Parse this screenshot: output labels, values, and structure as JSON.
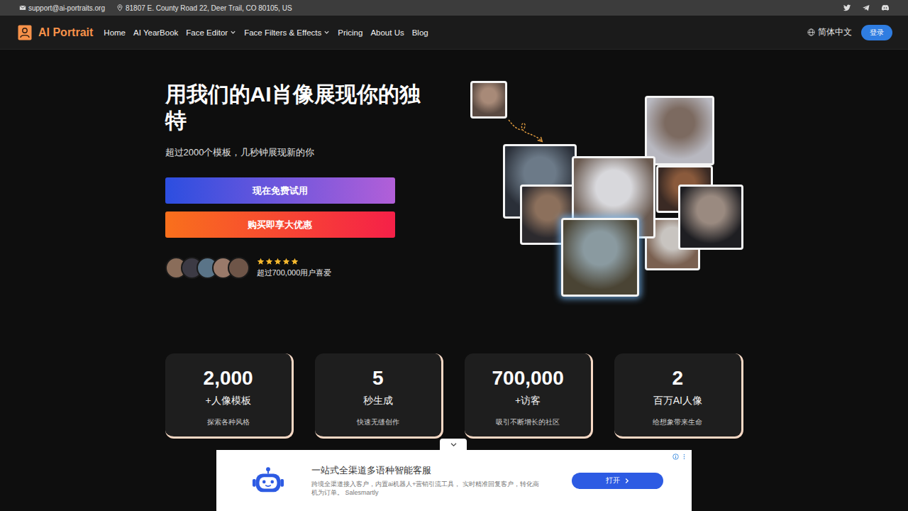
{
  "top_bar": {
    "email": "support@ai-portraits.org",
    "address": "81807 E. County Road 22, Deer Trail, CO 80105, US"
  },
  "nav": {
    "logo": "AI Portrait",
    "items": [
      {
        "label": "Home",
        "has_menu": false
      },
      {
        "label": "AI YearBook",
        "has_menu": false
      },
      {
        "label": "Face Editor",
        "has_menu": true
      },
      {
        "label": "Face Filters & Effects",
        "has_menu": true
      },
      {
        "label": "Pricing",
        "has_menu": false
      },
      {
        "label": "About Us",
        "has_menu": false
      },
      {
        "label": "Blog",
        "has_menu": false
      }
    ],
    "language": "简体中文",
    "login": "登录"
  },
  "hero": {
    "title": "用我们的AI肖像展现你的独特",
    "subtitle": "超过2000个模板，几秒钟展现新的你",
    "primary_button": "现在免费试用",
    "secondary_button": "购买即享大优惠",
    "stars": 5,
    "users": "超过700,000用户喜爱"
  },
  "stats": [
    {
      "value": "2,000",
      "label": "+人像模板",
      "caption": "探索各种风格"
    },
    {
      "value": "5",
      "label": "秒生成",
      "caption": "快速无缝创作"
    },
    {
      "value": "700,000",
      "label": "+访客",
      "caption": "吸引不断增长的社区"
    },
    {
      "value": "2",
      "label": "百万AI人像",
      "caption": "给想象带来生命"
    }
  ],
  "ad": {
    "title": "一站式全渠道多语种智能客服",
    "description": "跨境全渠道接入客户，内置ai机器人+营销引流工具， 实时精准回复客户，转化商机为订单。 Salesmartly",
    "button": "打开"
  }
}
